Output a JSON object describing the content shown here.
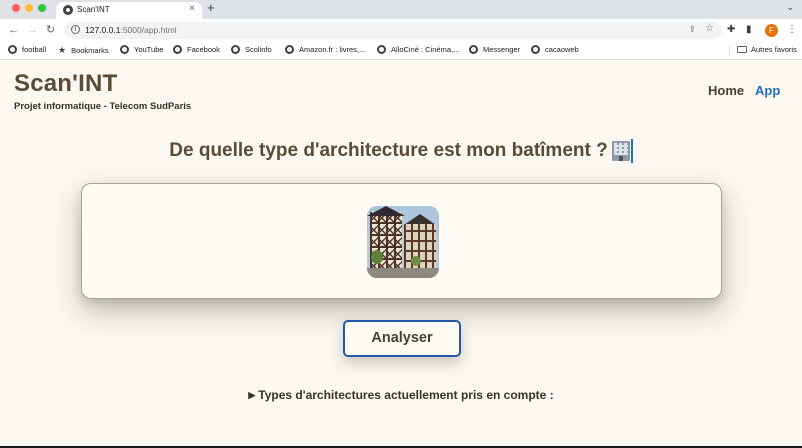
{
  "browser": {
    "tab": {
      "title": "Scan'INT",
      "close": "×"
    },
    "new_tab": "+",
    "address": {
      "host": "127.0.0.1",
      "rest": ":5000/app.html"
    },
    "profile_initial": "F",
    "bookmarks": [
      {
        "label": "football",
        "icon": "globe-icon"
      },
      {
        "label": "Bookmarks",
        "icon": "star-icon"
      },
      {
        "label": "YouTube",
        "icon": "globe-icon"
      },
      {
        "label": "Facebook",
        "icon": "globe-icon"
      },
      {
        "label": "Scolinfo",
        "icon": "globe-icon"
      },
      {
        "label": "Amazon.fr : livres,...",
        "icon": "globe-icon"
      },
      {
        "label": "AlloCiné : Cinéma,...",
        "icon": "globe-icon"
      },
      {
        "label": "Messenger",
        "icon": "globe-icon"
      },
      {
        "label": "cacaoweb",
        "icon": "globe-icon"
      }
    ],
    "other_bookmarks": "Autres favoris"
  },
  "header": {
    "logo": "Scan'INT",
    "tagline": "Projet informatique - Telecom SudParis",
    "nav": {
      "home": "Home",
      "app": "App"
    },
    "active_color": "#1f6fc4"
  },
  "main": {
    "question": "De quelle type d'architecture est mon batîment ?",
    "question_icon": "office-building-icon",
    "upload_image": "half-timbered-house-photo",
    "analyze_button": "Analyser",
    "details_summary": "Types d'architectures actuellement pris en compte :"
  }
}
